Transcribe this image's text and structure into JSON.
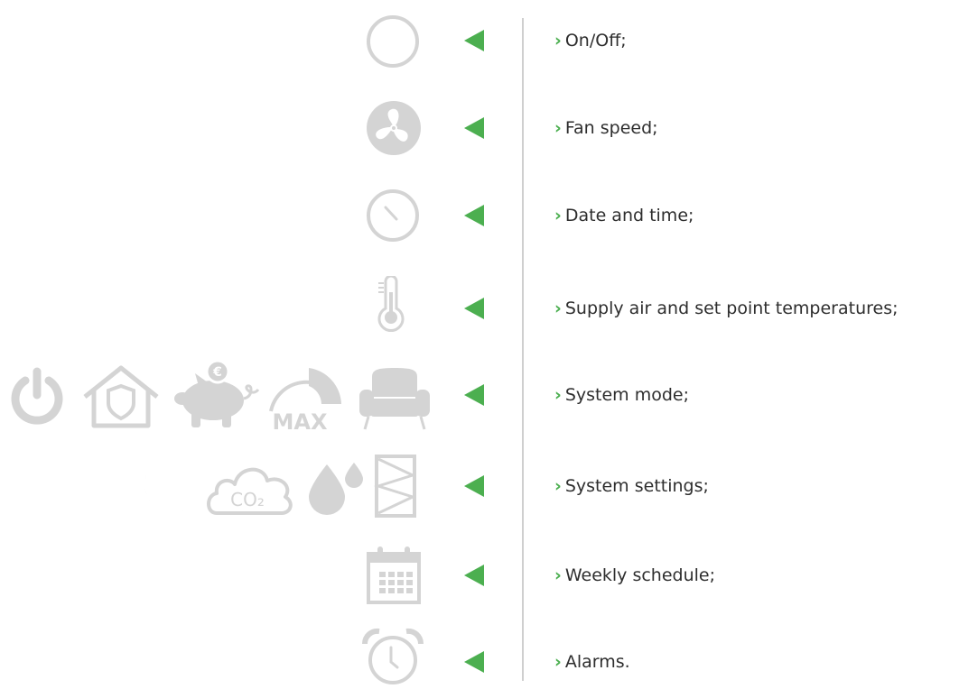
{
  "colors": {
    "icon": "#d4d4d4",
    "arrow": "#4caf50",
    "divider": "#cfcfcf",
    "text": "#2e2e2e"
  },
  "rows": [
    {
      "label": "On/Off;",
      "icons": [
        "power-ring-icon"
      ]
    },
    {
      "label": "Fan speed;",
      "icons": [
        "fan-icon"
      ]
    },
    {
      "label": "Date and time;",
      "icons": [
        "clock-icon"
      ]
    },
    {
      "label": "Supply air and set point temperatures;",
      "icons": [
        "thermometer-icon"
      ]
    },
    {
      "label": "System mode;",
      "icons": [
        "power-icon",
        "home-shield-icon",
        "piggy-bank-icon",
        "max-gauge-icon",
        "armchair-icon"
      ]
    },
    {
      "label": "System settings;",
      "icons": [
        "night-mode-icon",
        "co2-cloud-icon",
        "humidity-drops-icon",
        "filter-icon"
      ]
    },
    {
      "label": "Weekly schedule;",
      "icons": [
        "calendar-icon"
      ]
    },
    {
      "label": "Alarms.",
      "icons": [
        "alarm-clock-icon"
      ]
    }
  ],
  "text": {
    "max_label": "MAX",
    "co2_label": "CO₂",
    "euro_sign": "€",
    "chevron": "›"
  }
}
